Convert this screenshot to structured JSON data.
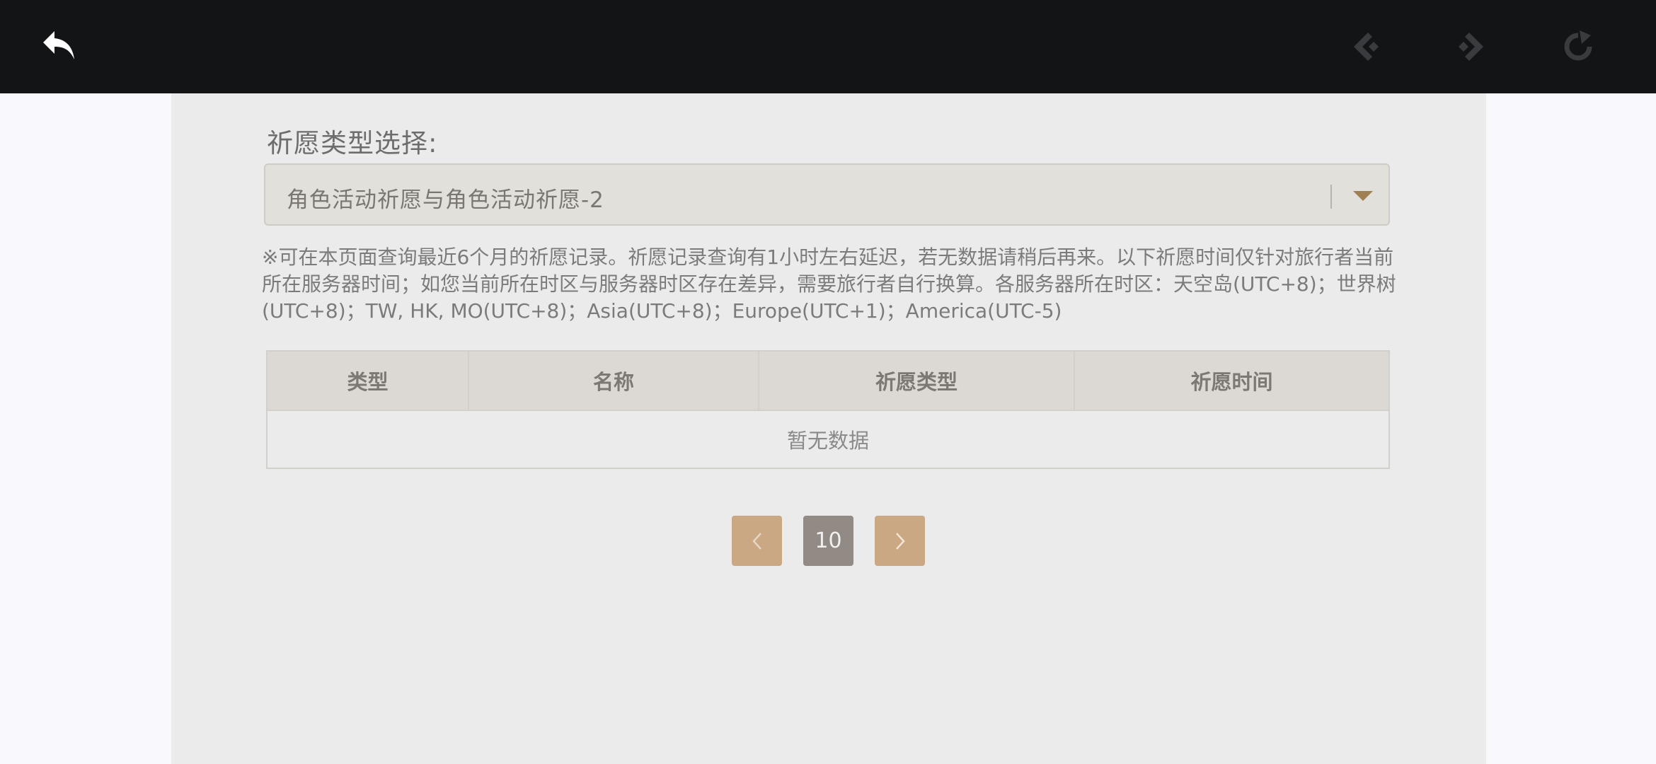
{
  "topbar": {
    "icons": [
      "back-arrow-icon",
      "prev-nav-icon",
      "next-nav-icon",
      "reload-icon"
    ]
  },
  "wish_type": {
    "label": "祈愿类型选择:",
    "selected": "角色活动祈愿与角色活动祈愿-2"
  },
  "notice": "※可在本页面查询最近6个月的祈愿记录。祈愿记录查询有1小时左右延迟，若无数据请稍后再来。以下祈愿时间仅针对旅行者当前所在服务器时间；如您当前所在时区与服务器时区存在差异，需要旅行者自行换算。各服务器所在时区：天空岛(UTC+8)；世界树(UTC+8)；TW, HK, MO(UTC+8)；Asia(UTC+8)；Europe(UTC+1)；America(UTC-5)",
  "table": {
    "headers": [
      "类型",
      "名称",
      "祈愿类型",
      "祈愿时间"
    ],
    "empty_text": "暂无数据"
  },
  "pagination": {
    "current_page": "10"
  },
  "colors": {
    "topbar": "#131416",
    "panel": "#ebebeb",
    "accent_button": "#c9a883",
    "current_page": "#928a84"
  }
}
